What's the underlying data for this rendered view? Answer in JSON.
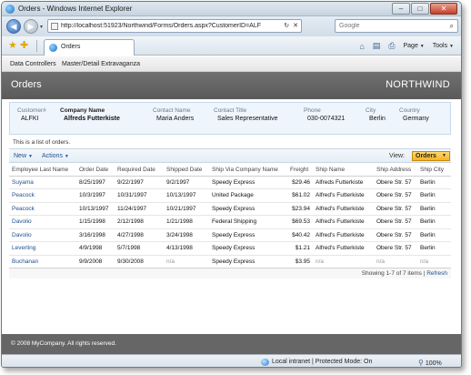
{
  "window": {
    "title": "Orders - Windows Internet Explorer",
    "minimize": "–",
    "maximize": "□",
    "close": "✕"
  },
  "addressbar": {
    "back_icon": "◀",
    "forward_icon": "▶",
    "history_caret": "▾",
    "url": "http://localhost:51923/Northwind/Forms/Orders.aspx?CustomerID=ALFKI",
    "refresh_icon": "↻",
    "stop_icon": "✕",
    "search_placeholder": "Google",
    "search_icon": "⌕"
  },
  "commandbar": {
    "tab_label": "Orders",
    "home_icon": "⌂",
    "feeds_icon": "▤",
    "print_icon": "⎙",
    "page_label": "Page",
    "tools_label": "Tools",
    "caret": "▼"
  },
  "menubar": {
    "items": [
      "Data Controllers",
      "Master/Detail Extravaganza"
    ]
  },
  "header": {
    "title": "Orders",
    "brand": "NORTHWIND"
  },
  "master": {
    "fields": [
      {
        "label": "Customer#",
        "value": "ALFKI"
      },
      {
        "label": "Company Name",
        "value": "Alfreds Futterkiste"
      },
      {
        "label": "Contact Name",
        "value": "Maria Anders"
      },
      {
        "label": "Contact Title",
        "value": "Sales Representative"
      },
      {
        "label": "Phone",
        "value": "030-0074321"
      },
      {
        "label": "City",
        "value": "Berlin"
      },
      {
        "label": "Country",
        "value": "Germany"
      }
    ]
  },
  "list_description": "This is a list of orders.",
  "toolbar": {
    "new_label": "New",
    "actions_label": "Actions",
    "caret": "▼",
    "view_label": "View:",
    "view_value": "Orders"
  },
  "grid": {
    "columns": [
      "Employee Last Name",
      "Order Date",
      "Required Date",
      "Shipped Date",
      "Ship Via Company Name",
      "Freight",
      "Ship Name",
      "Ship Address",
      "Ship City"
    ],
    "rows": [
      [
        "Suyama",
        "8/25/1997",
        "9/22/1997",
        "9/2/1997",
        "Speedy Express",
        "$29.46",
        "Alfreds Futterkiste",
        "Obere Str. 57",
        "Berlin"
      ],
      [
        "Peacock",
        "10/3/1997",
        "10/31/1997",
        "10/13/1997",
        "United Package",
        "$61.02",
        "Alfred's Futterkiste",
        "Obere Str. 57",
        "Berlin"
      ],
      [
        "Peacock",
        "10/13/1997",
        "11/24/1997",
        "10/21/1997",
        "Speedy Express",
        "$23.94",
        "Alfred's Futterkiste",
        "Obere Str. 57",
        "Berlin"
      ],
      [
        "Davolio",
        "1/15/1998",
        "2/12/1998",
        "1/21/1998",
        "Federal Shipping",
        "$69.53",
        "Alfred's Futterkiste",
        "Obere Str. 57",
        "Berlin"
      ],
      [
        "Davolio",
        "3/16/1998",
        "4/27/1998",
        "3/24/1998",
        "Speedy Express",
        "$40.42",
        "Alfred's Futterkiste",
        "Obere Str. 57",
        "Berlin"
      ],
      [
        "Leverling",
        "4/9/1998",
        "5/7/1998",
        "4/13/1998",
        "Speedy Express",
        "$1.21",
        "Alfred's Futterkiste",
        "Obere Str. 57",
        "Berlin"
      ],
      [
        "Buchanan",
        "9/9/2008",
        "9/30/2008",
        "n/a",
        "Speedy Express",
        "$3.95",
        "n/a",
        "n/a",
        "n/a"
      ]
    ]
  },
  "pager": {
    "text": "Showing 1-7 of 7 items |",
    "refresh": "Refresh"
  },
  "footer": {
    "copyright": "© 2008 MyCompany. All rights reserved."
  },
  "statusbar": {
    "zone": "Local intranet | Protected Mode: On",
    "zoom": "100%",
    "zoom_icon": "⚲"
  },
  "colors": {
    "accent": "#1f4f8f",
    "header_bg": "#646464",
    "view_select": "#f5b324"
  }
}
